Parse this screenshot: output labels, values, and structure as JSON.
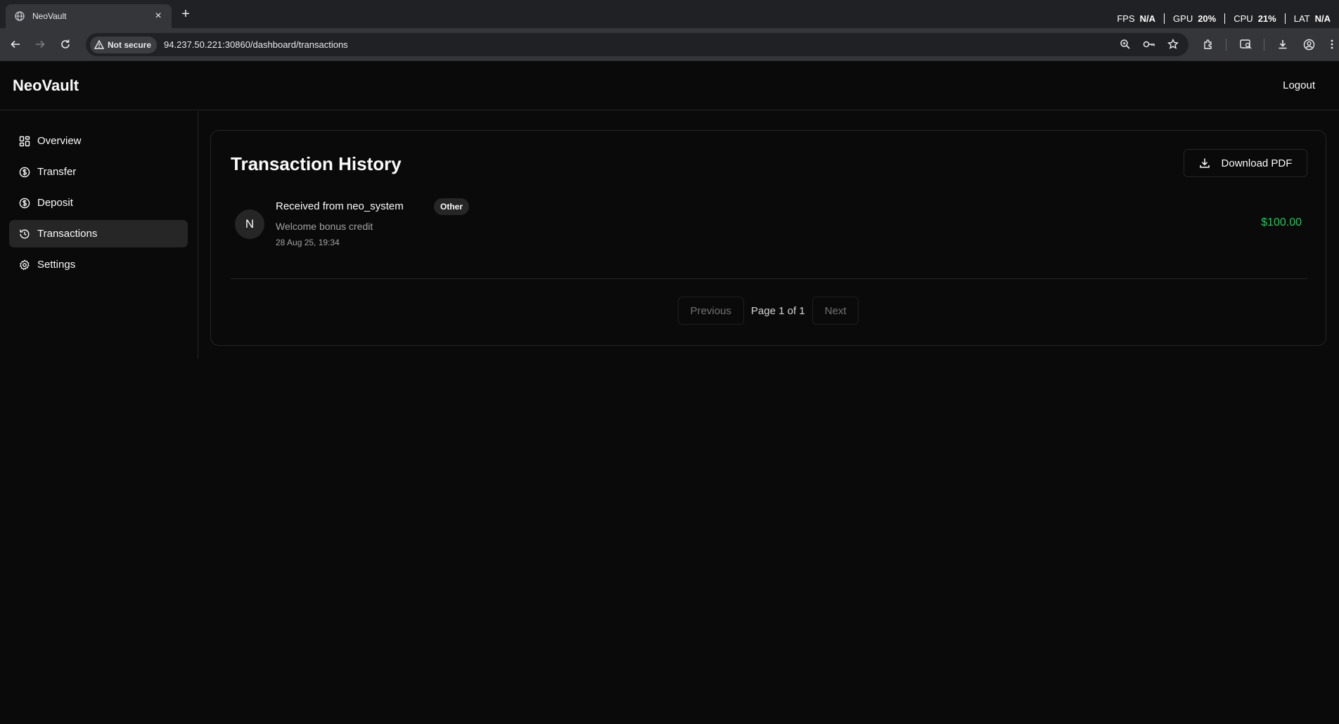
{
  "browser": {
    "tab_title": "NeoVault",
    "new_tab_symbol": "+",
    "close_symbol": "×",
    "security_label": "Not secure",
    "url": "94.237.50.221:30860/dashboard/transactions",
    "perf": {
      "fps_label": "FPS",
      "fps_value": "N/A",
      "gpu_label": "GPU",
      "gpu_value": "20%",
      "cpu_label": "CPU",
      "cpu_value": "21%",
      "lat_label": "LAT",
      "lat_value": "N/A"
    }
  },
  "app": {
    "brand": "NeoVault",
    "logout_label": "Logout"
  },
  "sidebar": {
    "items": [
      {
        "label": "Overview",
        "icon": "grid-icon"
      },
      {
        "label": "Transfer",
        "icon": "dollar-circle-icon"
      },
      {
        "label": "Deposit",
        "icon": "dollar-circle-icon"
      },
      {
        "label": "Transactions",
        "icon": "history-icon",
        "active": true
      },
      {
        "label": "Settings",
        "icon": "gear-icon"
      }
    ]
  },
  "main": {
    "title": "Transaction History",
    "download_label": "Download PDF",
    "transactions": [
      {
        "avatar_letter": "N",
        "title": "Received from neo_system",
        "category": "Other",
        "description": "Welcome bonus credit",
        "date": "28 Aug 25, 19:34",
        "amount": "$100.00"
      }
    ],
    "pagination": {
      "previous_label": "Previous",
      "page_text": "Page 1 of 1",
      "next_label": "Next"
    }
  },
  "colors": {
    "background": "#0a0a0a",
    "border": "#262626",
    "positive_amount": "#22c55e",
    "muted_text": "#a3a3a3"
  }
}
